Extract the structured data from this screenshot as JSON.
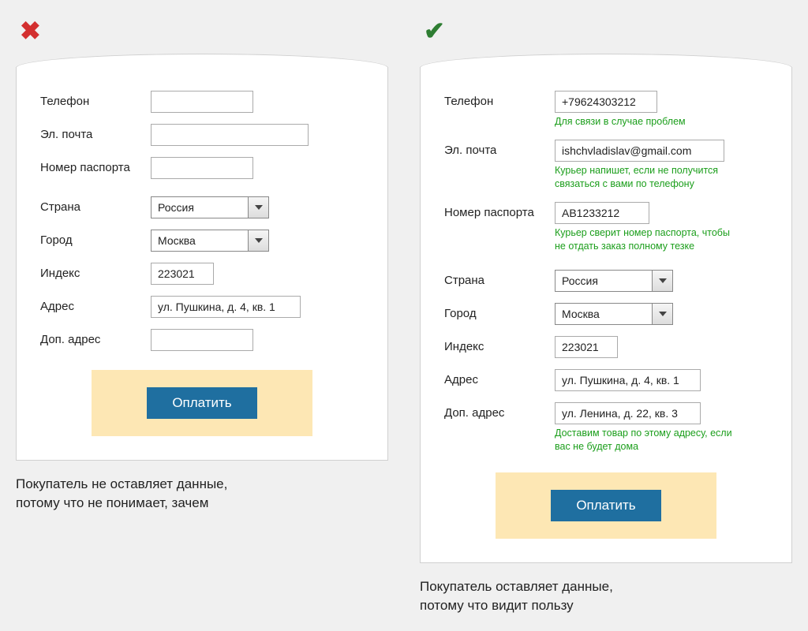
{
  "left": {
    "icon": "✖",
    "phone_label": "Телефон",
    "phone_value": "",
    "email_label": "Эл. почта",
    "email_value": "",
    "passport_label": "Номер паспорта",
    "passport_value": "",
    "country_label": "Страна",
    "country_value": "Россия",
    "city_label": "Город",
    "city_value": "Москва",
    "index_label": "Индекс",
    "index_value": "223021",
    "address_label": "Адрес",
    "address_value": "ул. Пушкина, д. 4, кв. 1",
    "addr2_label": "Доп. адрес",
    "addr2_value": "",
    "pay_button": "Оплатить",
    "caption_line1": "Покупатель не оставляет данные,",
    "caption_line2": "потому что не понимает, зачем"
  },
  "right": {
    "icon": "✔",
    "phone_label": "Телефон",
    "phone_value": "+79624303212",
    "phone_hint": "Для связи в случае проблем",
    "email_label": "Эл. почта",
    "email_value": "ishchvladislav@gmail.com",
    "email_hint": "Курьер напишет, если не получится связаться с вами по телефону",
    "passport_label": "Номер паспорта",
    "passport_value": "АВ1233212",
    "passport_hint": "Курьер сверит номер паспорта, чтобы не отдать заказ полному тезке",
    "country_label": "Страна",
    "country_value": "Россия",
    "city_label": "Город",
    "city_value": "Москва",
    "index_label": "Индекс",
    "index_value": "223021",
    "address_label": "Адрес",
    "address_value": "ул. Пушкина, д. 4, кв. 1",
    "addr2_label": "Доп. адрес",
    "addr2_value": "ул. Ленина, д. 22, кв. 3",
    "addr2_hint": "Доставим товар по этому адресу, если вас не будет дома",
    "pay_button": "Оплатить",
    "caption_line1": "Покупатель оставляет данные,",
    "caption_line2": "потому что видит пользу"
  }
}
